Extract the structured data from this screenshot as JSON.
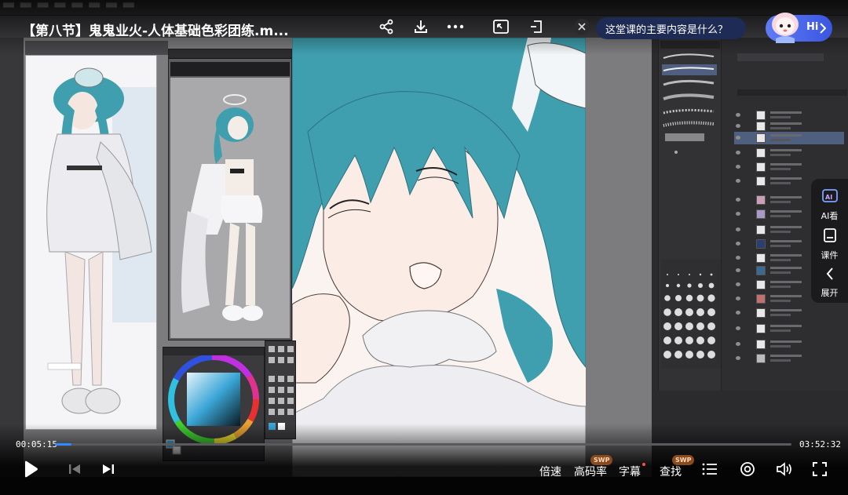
{
  "player": {
    "title": "【第八节】鬼鬼业火-人体基础色彩团练.m...",
    "ask_prompt": "这堂课的主要内容是什么？",
    "hi_label": "Hi",
    "side_dock": {
      "ai_label": "AI看",
      "courseware_label": "课件",
      "expand_label": "展开"
    },
    "time_current": "00:05:15",
    "time_total": "03:52:32",
    "progress": 0.0227,
    "controls": {
      "speed_label": "倍速",
      "bitrate_label": "高码率",
      "subtitle_label": "字幕",
      "search_label": "查找",
      "swp_badge": "SWP"
    }
  },
  "icons": {
    "share": "share-icon",
    "download": "download-icon",
    "more": "more-icon",
    "pip": "picture-in-picture-icon",
    "cast": "cast-icon",
    "close": "close-icon",
    "play": "play-icon",
    "prev": "skip-previous-icon",
    "next": "skip-next-icon",
    "playlist": "playlist-icon",
    "loop": "loop-icon",
    "volume": "volume-icon",
    "fullscreen": "fullscreen-icon"
  },
  "colors": {
    "accent": "#2f8cff",
    "ask_bubble": "#1d2b55",
    "hi_pill": "#4a66ea",
    "hair_teal": "#3f9fae"
  }
}
